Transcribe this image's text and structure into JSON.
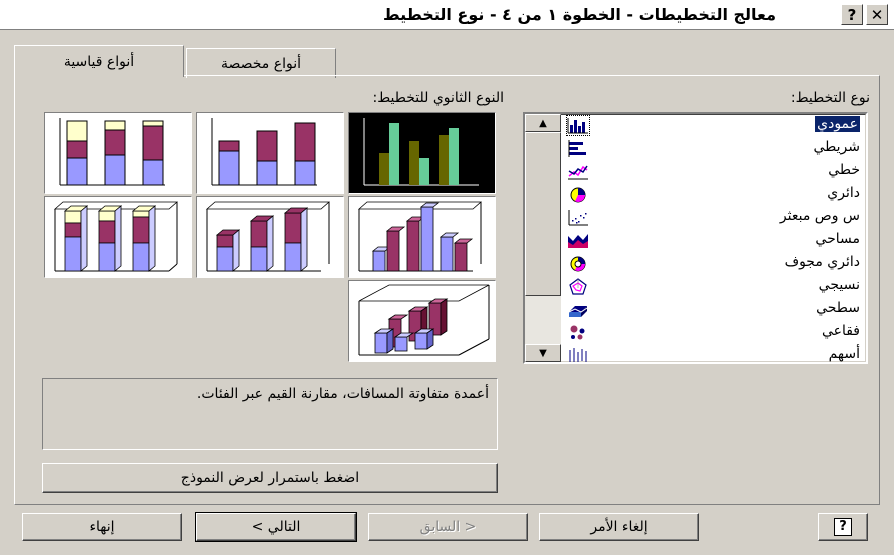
{
  "window": {
    "title": "معالج التخطيطات - الخطوة ١ من ٤ - نوع التخطيط",
    "help_label": "?",
    "close_label": "✕"
  },
  "tabs": [
    {
      "label": "أنواع قياسية",
      "selected": true
    },
    {
      "label": "أنواع مخصصة",
      "selected": false
    }
  ],
  "chart_type_label": "نوع التخطيط:",
  "subtype_label": "النوع الثانوي للتخطيط:",
  "chart_types": [
    {
      "label": "عمودي",
      "icon": "column-chart-icon",
      "selected": true
    },
    {
      "label": "شريطي",
      "icon": "bar-chart-icon"
    },
    {
      "label": "خطي",
      "icon": "line-chart-icon"
    },
    {
      "label": "دائري",
      "icon": "pie-chart-icon"
    },
    {
      "label": "س وص مبعثر",
      "icon": "scatter-chart-icon"
    },
    {
      "label": "مساحي",
      "icon": "area-chart-icon"
    },
    {
      "label": "دائري مجوف",
      "icon": "doughnut-chart-icon"
    },
    {
      "label": "نسيجي",
      "icon": "radar-chart-icon"
    },
    {
      "label": "سطحي",
      "icon": "surface-chart-icon"
    },
    {
      "label": "فقاعي",
      "icon": "bubble-chart-icon"
    },
    {
      "label": "أسهم",
      "icon": "stock-chart-icon"
    }
  ],
  "description": "أعمدة متفاوتة المسافات، مقارنة القيم عبر الفئات.",
  "preview_button": "اضغط باستمرار لعرض النموذج",
  "buttons": {
    "help_icon": "?",
    "cancel": "إلغاء الأمر",
    "back": "< السابق",
    "next": "التالي >",
    "finish": "إنهاء"
  },
  "colors": {
    "selection": "#0a246a",
    "series_1": "#9999ff",
    "series_2": "#993366",
    "series_3": "#ffffcc"
  }
}
